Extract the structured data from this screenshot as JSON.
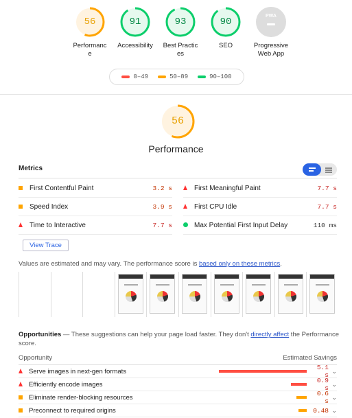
{
  "gauges": [
    {
      "score": "56",
      "label": "Performance",
      "color": "#ffa400",
      "fraction": 0.56,
      "bg": "#fff3e0"
    },
    {
      "score": "91",
      "label": "Accessibility",
      "color": "#0cce6b",
      "fraction": 0.91,
      "bg": "#e6f9ee"
    },
    {
      "score": "93",
      "label": "Best Practices",
      "color": "#0cce6b",
      "fraction": 0.93,
      "bg": "#e6f9ee"
    },
    {
      "score": "90",
      "label": "SEO",
      "color": "#0cce6b",
      "fraction": 0.9,
      "bg": "#e6f9ee"
    }
  ],
  "pwa": {
    "badge": "PWA",
    "label": "Progressive Web App"
  },
  "legend": [
    {
      "range": "0–49",
      "color": "#ff4e42"
    },
    {
      "range": "50–89",
      "color": "#ffa400"
    },
    {
      "range": "90–100",
      "color": "#0cce6b"
    }
  ],
  "performance": {
    "score": "56",
    "title": "Performance",
    "fraction": 0.56
  },
  "metrics": {
    "header": "Metrics",
    "items": [
      {
        "label": "First Contentful Paint",
        "value": "3.2 s",
        "status": "average"
      },
      {
        "label": "First Meaningful Paint",
        "value": "7.7 s",
        "status": "fail"
      },
      {
        "label": "Speed Index",
        "value": "3.9 s",
        "status": "average"
      },
      {
        "label": "First CPU Idle",
        "value": "7.7 s",
        "status": "fail"
      },
      {
        "label": "Time to Interactive",
        "value": "7.7 s",
        "status": "fail"
      },
      {
        "label": "Max Potential First Input Delay",
        "value": "110 ms",
        "status": "pass"
      }
    ]
  },
  "view_trace": "View Trace",
  "estimate": {
    "text": "Values are estimated and may vary. The performance score is ",
    "link": "based only on these metrics",
    "end": "."
  },
  "opportunities": {
    "title": "Opportunities",
    "desc": " — These suggestions can help your page load faster. They don't ",
    "link": "directly affect",
    "desc_end": " the Performance score.",
    "col_left": "Opportunity",
    "col_right": "Estimated Savings",
    "items": [
      {
        "label": "Serve images in next-gen formats",
        "value": "5.1 s",
        "status": "fail",
        "fraction": 1.0
      },
      {
        "label": "Efficiently encode images",
        "value": "0.9 s",
        "status": "fail",
        "fraction": 0.18
      },
      {
        "label": "Eliminate render-blocking resources",
        "value": "0.6 s",
        "status": "average",
        "fraction": 0.12
      },
      {
        "label": "Preconnect to required origins",
        "value": "0.48",
        "status": "average",
        "fraction": 0.09
      }
    ]
  },
  "colors": {
    "fail": "#ff4e42",
    "average": "#ffa400",
    "pass": "#0cce6b",
    "accent": "#2a63e3"
  }
}
